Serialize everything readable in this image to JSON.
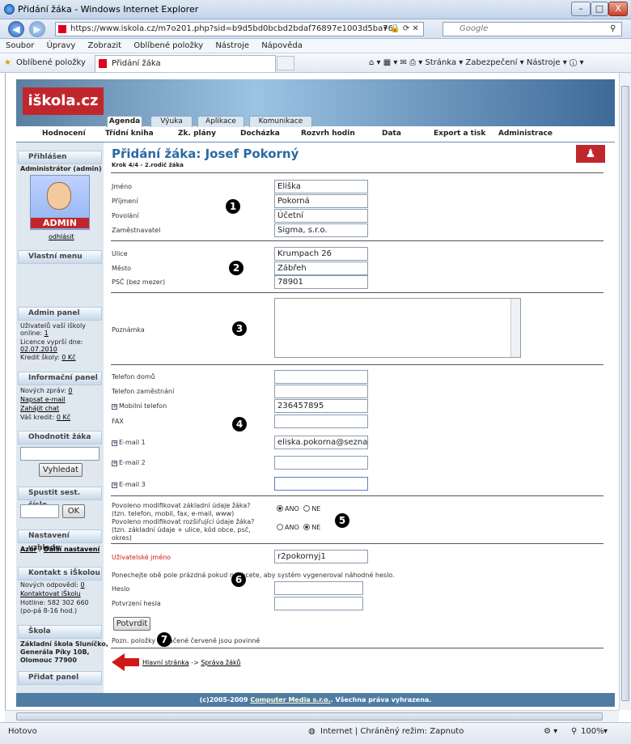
{
  "window": {
    "title": "Přidání žáka - Windows Internet Explorer",
    "min": "–",
    "max": "□",
    "close": "X"
  },
  "browser": {
    "back": "◀",
    "fwd": "▶",
    "url": "https://www.iskola.cz/m7o201.php?sid=b9d5bd0bcbd2bdaf76897e1003d5ba76",
    "search_placeholder": "Google"
  },
  "menu": [
    "Soubor",
    "Úpravy",
    "Zobrazit",
    "Oblíbené položky",
    "Nástroje",
    "Nápověda"
  ],
  "favorites": {
    "label": "Oblíbené položky",
    "tab": "Přidání žáka",
    "tools": "Stránka ▾  Zabezpečení ▾  Nástroje ▾"
  },
  "site": {
    "logo": "iškola.cz",
    "tabs": [
      "Agenda",
      "Výuka",
      "Aplikace",
      "Komunikace"
    ],
    "nav": [
      "Hodnocení",
      "Třídní kniha",
      "Zk. plány",
      "Docházka",
      "Rozvrh hodin",
      "Data",
      "Export a tisk",
      "Administrace"
    ]
  },
  "sidebar": {
    "login": {
      "title": "Přihlášen",
      "user": "Administrátor (admin)",
      "avatar": "ADMIN",
      "logout": "odhlásit"
    },
    "own_menu": "Vlastní menu",
    "admin": {
      "title": "Admin panel",
      "l1": "Uživatelů vaší iškoly",
      "l2": "online:",
      "online": "1",
      "l3": "Licence vyprší dne:",
      "date": "02.07.2010",
      "l4": "Kredit školy:",
      "credit": "0 Kč"
    },
    "info": {
      "title": "Informační panel",
      "l1": "Nových zpráv:",
      "msgs": "0",
      "send": "Napsat e-mail",
      "chat": "Zahájit chat",
      "l2": "Váš kredit:",
      "credit": "0 Kč"
    },
    "rate": {
      "title": "Ohodnotit žáka",
      "button": "Vyhledat"
    },
    "serial": {
      "title": "Spustit sest. číslo",
      "button": "OK"
    },
    "look": {
      "title": "Nastavení vzhledu",
      "azur": "Azur",
      "sep": " / ",
      "more": "Další nastavení"
    },
    "contact": {
      "title": "Kontakt s iŠkolou",
      "l1": "Nových odpovědí:",
      "answers": "0",
      "link": "Kontaktovat iŠkolu",
      "hotline": "Hotline: 582 302 660",
      "hours": "(po-pá 8-16 hod.)"
    },
    "school": {
      "title": "Škola",
      "l1": "Základní škola Sluníčko,",
      "l2": "Generála Píky 10B,",
      "l3": "Olomouc 77900"
    },
    "add": "Přidat panel"
  },
  "form": {
    "title": "Přidání žáka: Josef Pokorný",
    "step": "Krok 4/4 - 2.rodič žáka",
    "fields": {
      "jmeno": "Jméno",
      "jmeno_v": "Eliška",
      "prijmeni": "Příjmení",
      "prijmeni_v": "Pokorná",
      "povolani": "Povolání",
      "povolani_v": "Účetní",
      "zam": "Zaměstnavatel",
      "zam_v": "Sigma, s.r.o.",
      "ulice": "Ulice",
      "ulice_v": "Krumpach 26",
      "mesto": "Město",
      "mesto_v": "Zábřeh",
      "psc": "PSČ (bez mezer)",
      "psc_v": "78901",
      "poznamka": "Poznámka",
      "tel_dom": "Telefon domů",
      "tel_zam": "Telefon zaměstnání",
      "mobil": "Mobilní telefon",
      "mobil_v": "236457895",
      "fax": "FAX",
      "email1": "E-mail 1",
      "email1_v": "eliska.pokorna@seznam.cz",
      "email2": "E-mail 2",
      "email3": "E-mail 3",
      "mod1a": "Povoleno modifikovat základní údaje žáka?",
      "mod1b": "(tzn. telefon, mobil, fax, e-mail, www)",
      "mod2a": "Povoleno modifikovat rozšiřující údaje žáka?",
      "mod2b": "(tzn. základní údaje + ulice, kód obce, psč,",
      "mod2c": "okres)",
      "ano": "ANO",
      "ne": "NE",
      "uzivatel": "Uživatelské jméno",
      "uzivatel_v": "r2pokornyj1",
      "hint": "Ponechejte obě pole prázdná pokud nechcete, aby systém vygeneroval náhodné heslo.",
      "heslo": "Heslo",
      "heslo2": "Potvrzení hesla",
      "submit": "Potvrdit",
      "note": "Pozn. položky označené červeně jsou povinné"
    },
    "nums": [
      "1",
      "2",
      "3",
      "4",
      "5",
      "6",
      "7"
    ],
    "bc_home": "Hlavní stránka",
    "bc_sep": " -> ",
    "bc_page": "Správa žáků"
  },
  "footer": {
    "copy": "(c)2005-2009 ",
    "company": "Computer Media s.r.o.",
    "rights": ". Všechna práva vyhrazena."
  },
  "status": {
    "left": "Hotovo",
    "zone": "Internet | Chráněný režim: Zapnuto",
    "zoom": "100%"
  }
}
